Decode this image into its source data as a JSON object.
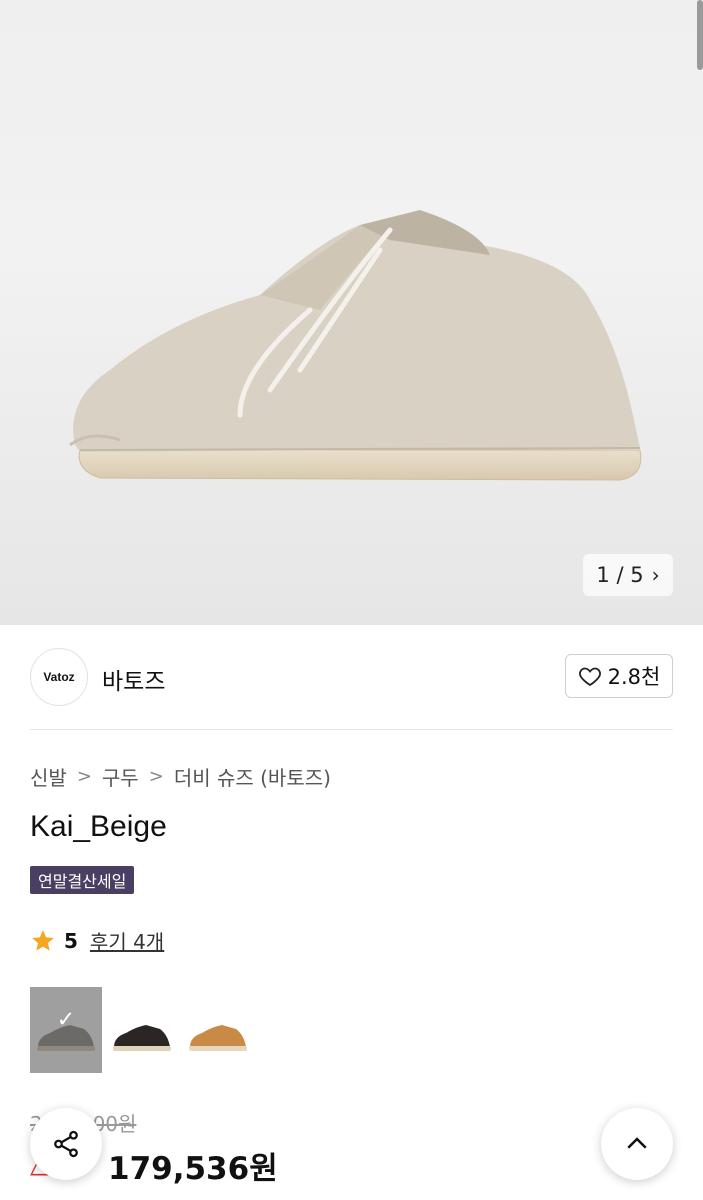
{
  "gallery": {
    "counter_current": "1",
    "counter_sep": "/",
    "counter_total": "5"
  },
  "brand": {
    "logo_text": "Vatoz",
    "name": "바토즈",
    "like_count": "2.8천"
  },
  "breadcrumb": [
    "신발",
    "구두",
    "더비 슈즈 (바토즈)"
  ],
  "product": {
    "title": "Kai_Beige",
    "badge": "연말결산세일",
    "rating": "5",
    "reviews": "후기 4개",
    "original_price": "2△△,000원",
    "discount": "△△",
    "price": "179,536원"
  },
  "swatches": [
    {
      "name": "grey",
      "color": "#8e8a80",
      "selected": true
    },
    {
      "name": "black",
      "color": "#2b2623",
      "selected": false
    },
    {
      "name": "tan",
      "color": "#c98a45",
      "selected": false
    }
  ],
  "colors": {
    "badge_bg": "#4a3f63",
    "discount_red": "#e0312d",
    "star": "#f5a623"
  }
}
